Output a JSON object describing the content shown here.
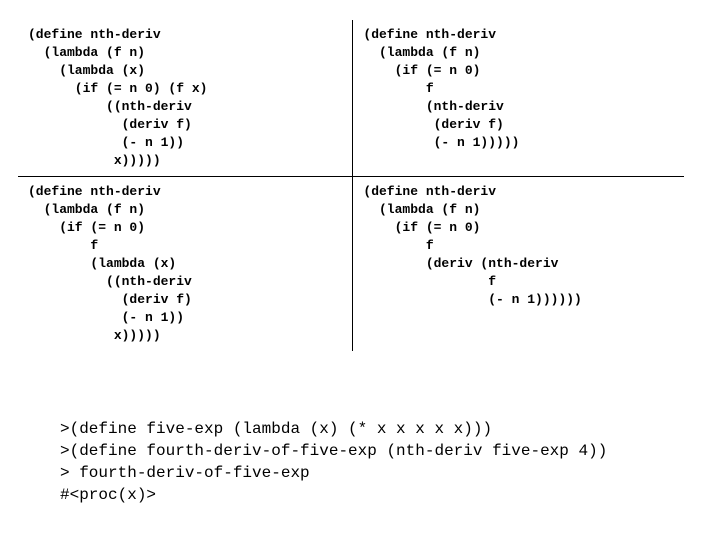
{
  "quadrants": {
    "tl": "(define nth-deriv\n  (lambda (f n)\n    (lambda (x)\n      (if (= n 0) (f x)\n          ((nth-deriv\n            (deriv f)\n            (- n 1))\n           x)))))",
    "tr": "(define nth-deriv\n  (lambda (f n)\n    (if (= n 0)\n        f\n        (nth-deriv\n         (deriv f)\n         (- n 1)))))",
    "bl": "(define nth-deriv\n  (lambda (f n)\n    (if (= n 0)\n        f\n        (lambda (x)\n          ((nth-deriv\n            (deriv f)\n            (- n 1))\n           x)))))",
    "br": "(define nth-deriv\n  (lambda (f n)\n    (if (= n 0)\n        f\n        (deriv (nth-deriv\n                f\n                (- n 1))))))"
  },
  "console": ">(define five-exp (lambda (x) (* x x x x x)))\n>(define fourth-deriv-of-five-exp (nth-deriv five-exp 4))\n> fourth-deriv-of-five-exp\n#<proc(x)>"
}
